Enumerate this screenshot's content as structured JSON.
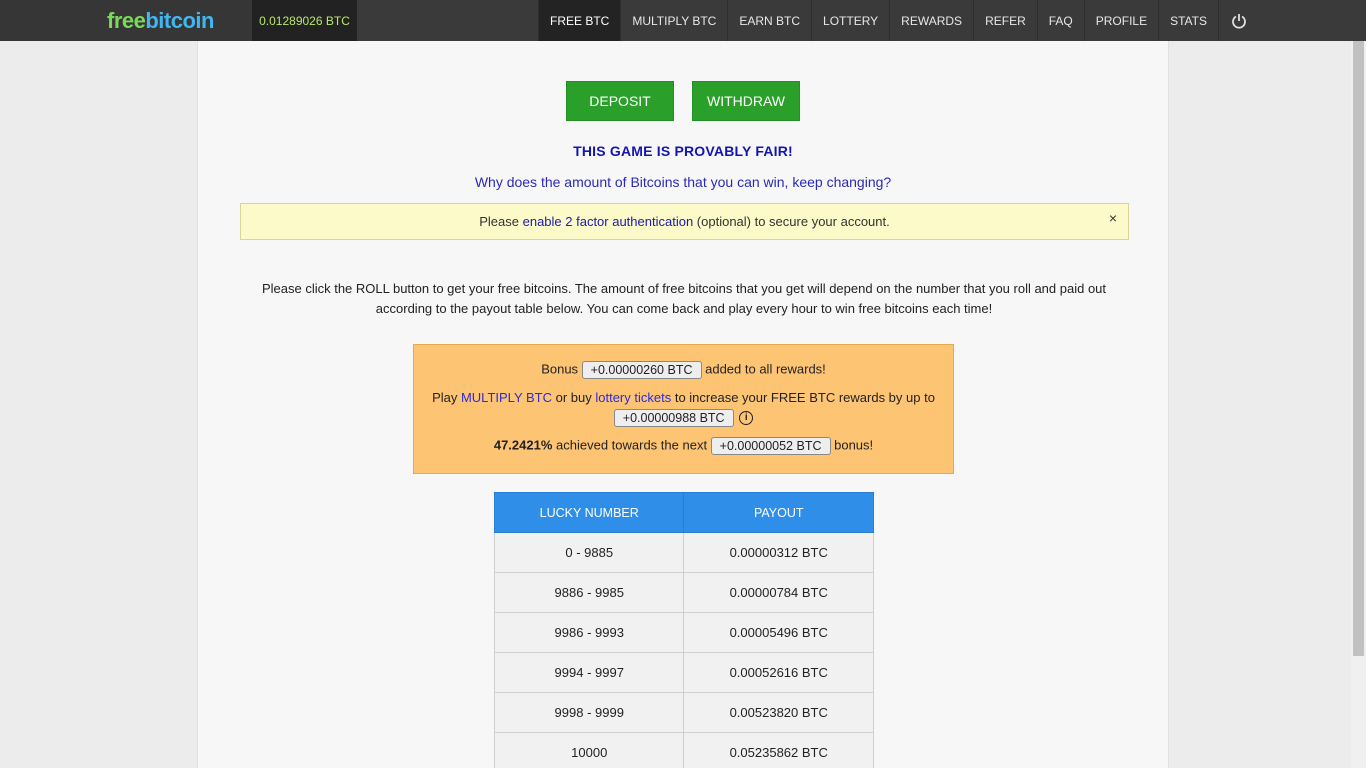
{
  "header": {
    "logo_free": "free",
    "logo_bitcoin": "bitcoin",
    "balance": "0.01289026 BTC",
    "nav": [
      {
        "label": "FREE BTC"
      },
      {
        "label": "MULTIPLY BTC"
      },
      {
        "label": "EARN BTC"
      },
      {
        "label": "LOTTERY"
      },
      {
        "label": "REWARDS"
      },
      {
        "label": "REFER"
      },
      {
        "label": "FAQ"
      },
      {
        "label": "PROFILE"
      },
      {
        "label": "STATS"
      }
    ],
    "power_icon": "power-icon"
  },
  "actions": {
    "deposit": "DEPOSIT",
    "withdraw": "WITHDRAW"
  },
  "fair_title": "THIS GAME IS PROVABLY FAIR!",
  "why_link": "Why does the amount of Bitcoins that you can win, keep changing?",
  "alert": {
    "prefix": "Please ",
    "link": "enable 2 factor authentication",
    "suffix": " (optional) to secure your account.",
    "close": "×"
  },
  "intro": "Please click the ROLL button to get your free bitcoins. The amount of free bitcoins that you get will depend on the number that you roll and paid out according to the payout table below. You can come back and play every hour to win free bitcoins each time!",
  "bonus": {
    "line1_prefix": "Bonus ",
    "line1_value": "+0.00000260 BTC",
    "line1_suffix": " added to all rewards!",
    "line2_prefix": "Play ",
    "line2_link1": "MULTIPLY BTC",
    "line2_mid": " or buy ",
    "line2_link2": "lottery tickets",
    "line2_suffix": " to increase your FREE BTC rewards by up to",
    "line3_value": "+0.00000988 BTC",
    "info_icon": "i",
    "line4_percent": "47.2421%",
    "line4_mid": " achieved towards the next ",
    "line4_value": "+0.00000052 BTC",
    "line4_suffix": " bonus!"
  },
  "payout": {
    "headers": [
      "LUCKY NUMBER",
      "PAYOUT"
    ],
    "rows": [
      [
        "0 - 9885",
        "0.00000312 BTC"
      ],
      [
        "9886 - 9985",
        "0.00000784 BTC"
      ],
      [
        "9986 - 9993",
        "0.00005496 BTC"
      ],
      [
        "9994 - 9997",
        "0.00052616 BTC"
      ],
      [
        "9998 - 9999",
        "0.00523820 BTC"
      ],
      [
        "10000",
        "0.05235862 BTC"
      ]
    ]
  }
}
